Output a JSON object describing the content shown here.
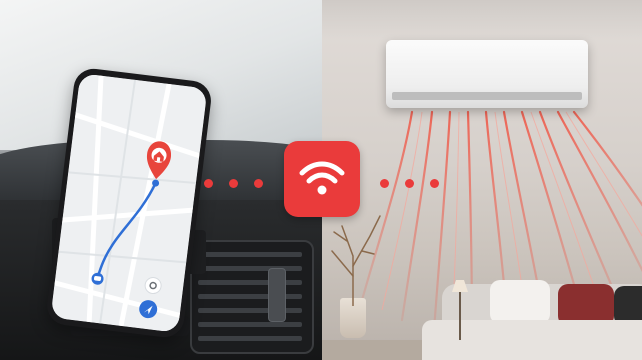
{
  "scene": {
    "left": "car-dashboard-with-phone-navigation",
    "right": "living-room-air-conditioner-cooling",
    "connector": "wifi-icon"
  },
  "colors": {
    "accent_red": "#ea3b3b",
    "map_route_blue": "#2f6fd6",
    "map_pin_red": "#e8453c",
    "airflow_red": "#ef5a4a"
  },
  "icons": [
    "wifi-icon",
    "location-pin-icon",
    "home-icon",
    "car-icon",
    "navigation-arrow-icon",
    "settings-icon"
  ]
}
